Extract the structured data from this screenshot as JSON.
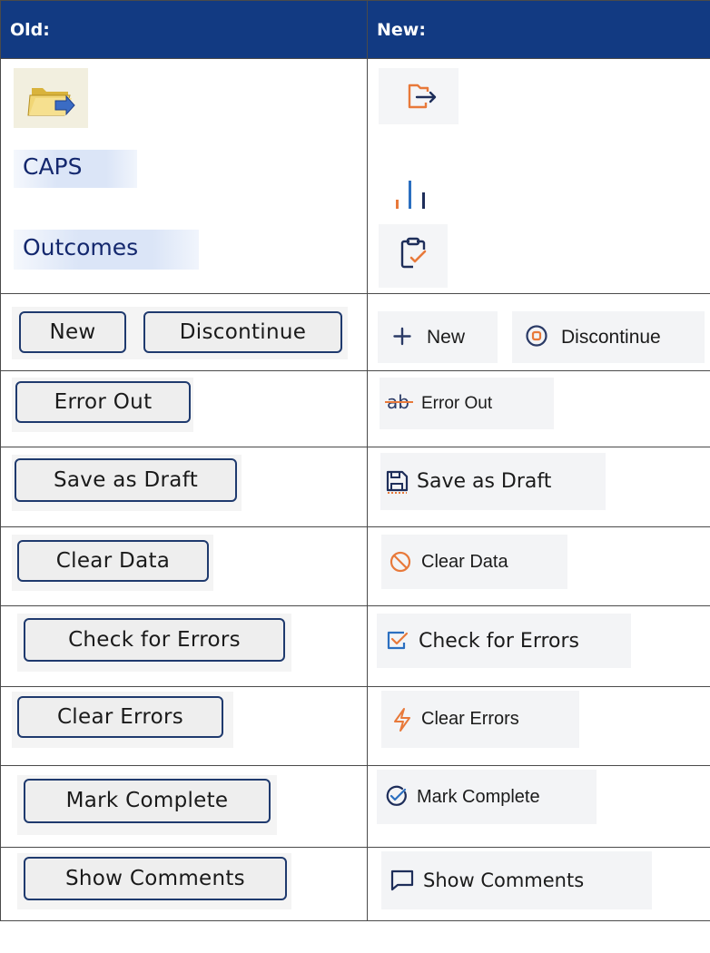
{
  "headers": {
    "old": "Old:",
    "new": "New:"
  },
  "nav_items": {
    "old": {
      "caps": "CAPS",
      "outcomes": "Outcomes"
    },
    "new_icons": [
      "exit-icon",
      "bar-chart-icon",
      "clipboard-check-icon"
    ]
  },
  "old_buttons": {
    "new": "New",
    "discontinue": "Discontinue",
    "error_out": "Error Out",
    "save_as_draft": "Save as Draft",
    "clear_data": "Clear Data",
    "check_for_errors": "Check for Errors",
    "clear_errors": "Clear Errors",
    "mark_complete": "Mark Complete",
    "show_comments": "Show Comments"
  },
  "new_buttons": {
    "new": {
      "label": "New",
      "icon": "plus-icon"
    },
    "discontinue": {
      "label": "Discontinue",
      "icon": "stop-circle-icon"
    },
    "error_out": {
      "label": "Error Out",
      "icon": "strikethrough-ab-icon"
    },
    "save_as_draft": {
      "label": "Save as Draft",
      "icon": "save-draft-icon"
    },
    "clear_data": {
      "label": "Clear Data",
      "icon": "prohibited-icon"
    },
    "check_for_errors": {
      "label": "Check for Errors",
      "icon": "checkbox-icon"
    },
    "clear_errors": {
      "label": "Clear Errors",
      "icon": "lightning-icon"
    },
    "mark_complete": {
      "label": "Mark Complete",
      "icon": "check-circle-icon"
    },
    "show_comments": {
      "label": "Show Comments",
      "icon": "comment-icon"
    }
  },
  "colors": {
    "header_bg": "#123a82",
    "header_text": "#ffffff",
    "old_nav_text": "#14286e",
    "old_button_border": "#1f3a6e",
    "orange_accent": "#e8793a",
    "blue_accent": "#2b6fc0",
    "dark_navy_icon": "#1e2e5a"
  }
}
